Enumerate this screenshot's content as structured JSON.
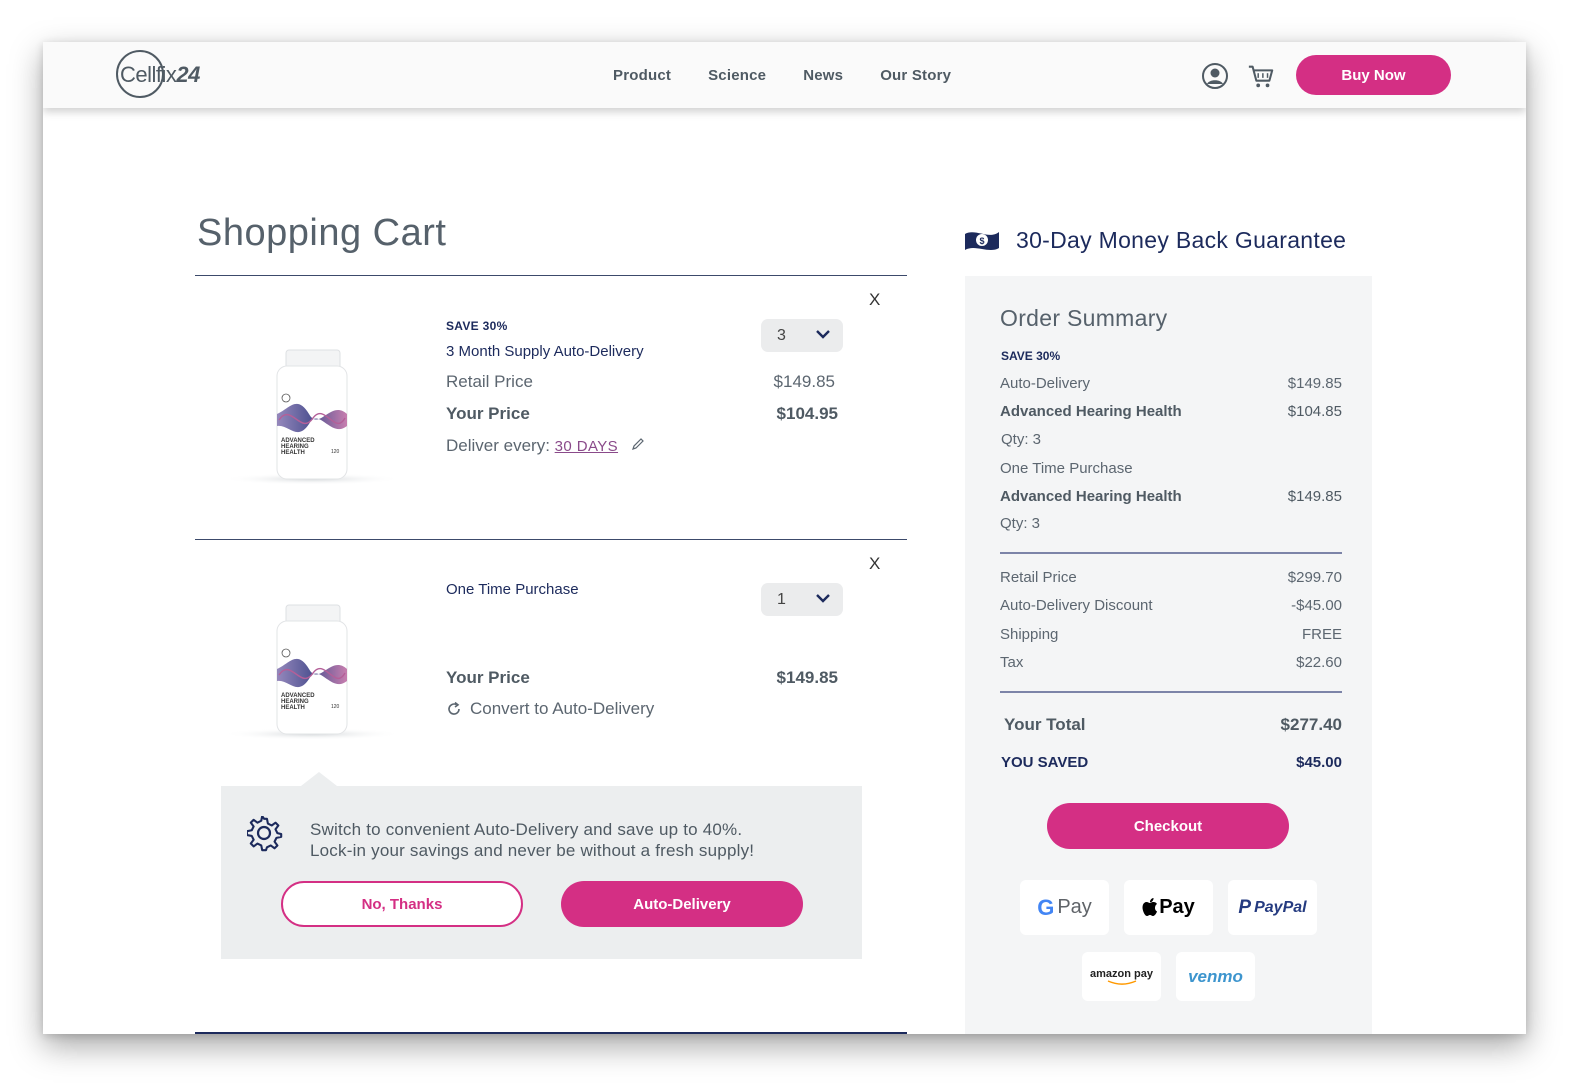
{
  "header": {
    "logo_text_light": "Cellfix",
    "logo_text_bold": "24",
    "nav": [
      "Product",
      "Science",
      "News",
      "Our Story"
    ],
    "buy_now": "Buy Now",
    "icons": [
      "account-icon",
      "cart-icon"
    ]
  },
  "cart": {
    "title": "Shopping Cart",
    "remove_label": "X",
    "items": [
      {
        "save_tag": "SAVE 30%",
        "name": "3 Month Supply Auto-Delivery",
        "qty": "3",
        "retail_label": "Retail Price",
        "retail_value": "$149.85",
        "price_label": "Your Price",
        "price_value": "$104.95",
        "deliver_label": "Deliver every:",
        "deliver_value": "30 DAYS"
      },
      {
        "name": "One Time Purchase",
        "qty": "1",
        "price_label": "Your Price",
        "price_value": "$149.85",
        "convert_label": "Convert to Auto-Delivery"
      }
    ],
    "product_label": {
      "brand": "Cellfix24",
      "line1": "ADVANCED",
      "line2": "HEARING",
      "line3": "HEALTH",
      "count": "120"
    },
    "popup": {
      "line1": "Switch to convenient Auto-Delivery and save up to 40%.",
      "line2": "Lock-in your savings and never be without a fresh supply!",
      "no_thanks": "No, Thanks",
      "auto_delivery": "Auto-Delivery"
    }
  },
  "guarantee": "30-Day Money Back Guarantee",
  "summary": {
    "title": "Order Summary",
    "save_tag": "SAVE 30%",
    "auto_label": "Auto-Delivery",
    "auto_value": "$149.85",
    "item1_name": "Advanced Hearing Health",
    "item1_value": "$104.85",
    "item1_qty": "Qty: 3",
    "one_time_label": "One Time Purchase",
    "item2_name": "Advanced Hearing Health",
    "item2_value": "$149.85",
    "item2_qty": "Qty: 3",
    "retail_label": "Retail Price",
    "retail_value": "$299.70",
    "discount_label": "Auto-Delivery Discount",
    "discount_value": "-$45.00",
    "shipping_label": "Shipping",
    "shipping_value": "FREE",
    "tax_label": "Tax",
    "tax_value": "$22.60",
    "total_label": "Your Total",
    "total_value": "$277.40",
    "saved_label": "YOU SAVED",
    "saved_value": "$45.00",
    "checkout": "Checkout",
    "payments": {
      "gpay_g": "G",
      "gpay_text": "Pay",
      "applepay": "Pay",
      "paypal_p": "P",
      "paypal": "PayPal",
      "amazonpay": "amazon pay",
      "venmo": "venmo"
    }
  },
  "colors": {
    "brand_pink": "#d42f84",
    "navy": "#1c2a5c",
    "text_gray": "#4f5a63",
    "panel_gray": "#f4f5f6"
  }
}
